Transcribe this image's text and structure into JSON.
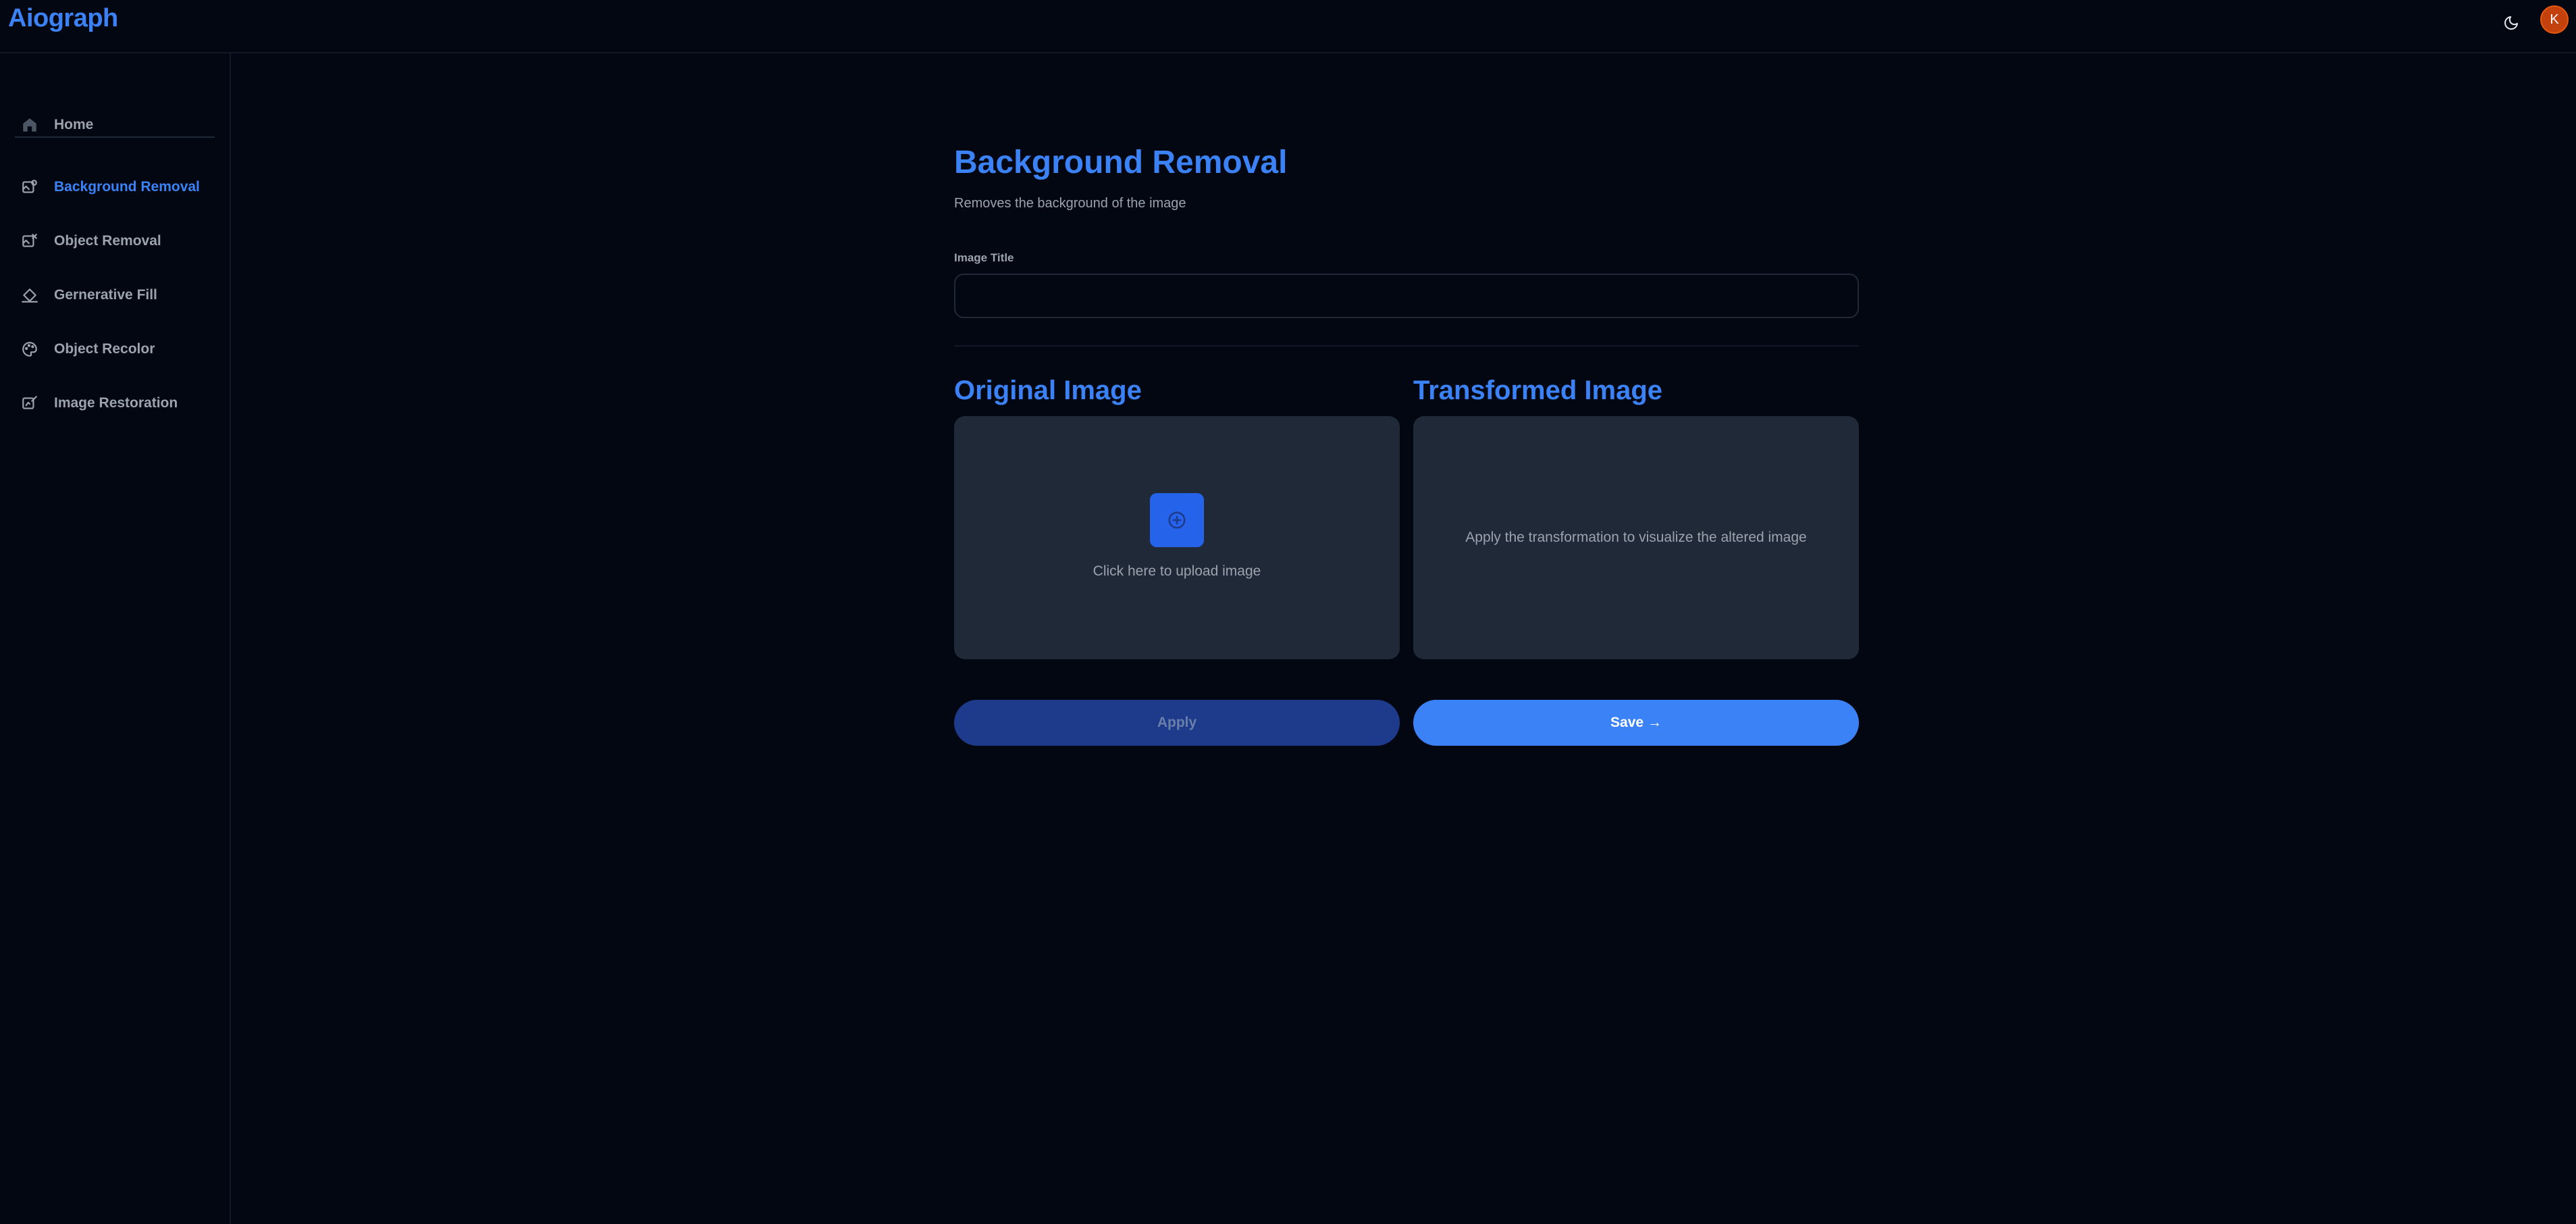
{
  "app": {
    "name": "Aiograph",
    "avatar_initial": "K"
  },
  "sidebar": {
    "items": [
      {
        "label": "Home",
        "icon": "home-icon"
      },
      {
        "label": "Background Removal",
        "icon": "image-bg-icon",
        "active": true
      },
      {
        "label": "Object Removal",
        "icon": "image-remove-icon"
      },
      {
        "label": "Gernerative Fill",
        "icon": "paint-bucket-icon"
      },
      {
        "label": "Object Recolor",
        "icon": "palette-icon"
      },
      {
        "label": "Image Restoration",
        "icon": "edit-image-icon"
      }
    ]
  },
  "main": {
    "title": "Background Removal",
    "subtitle": "Removes the background of the image",
    "image_title_label": "Image Title",
    "image_title_value": "",
    "original": {
      "heading": "Original Image",
      "upload_text": "Click here to upload image"
    },
    "transformed": {
      "heading": "Transformed Image",
      "placeholder": "Apply the transformation to visualize the altered image"
    },
    "apply_label": "Apply",
    "save_label": "Save →"
  },
  "colors": {
    "accent": "#3b82f6",
    "background": "#030712",
    "panel": "#1f2937",
    "avatar": "#c2410c"
  }
}
